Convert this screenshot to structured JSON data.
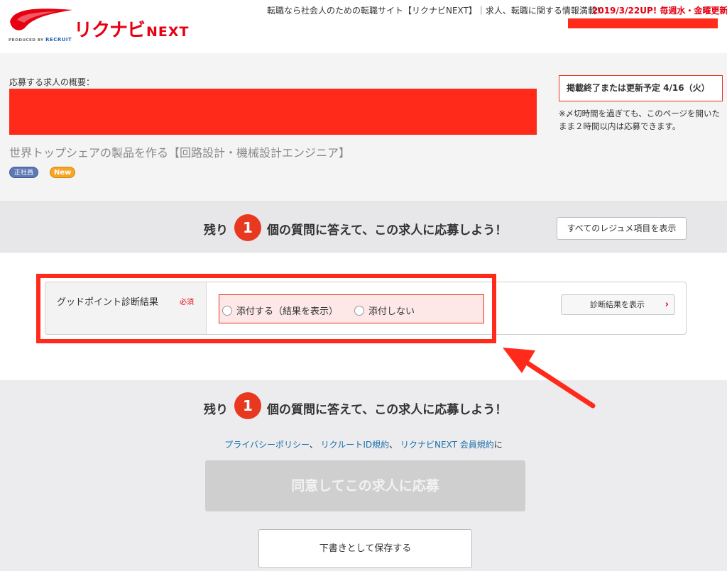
{
  "header": {
    "logo": {
      "main_text": "リクナビ",
      "next_text": "NEXT",
      "produced_by": "PRODUCED BY",
      "recruit": "RECRUIT"
    },
    "tagline": "転職なら社会人のための転職サイト【リクナビNEXT】｜求人、転職に関する情報満載！",
    "update": "2019/3/22UP! 毎週水・金曜更新"
  },
  "overview": {
    "label": "応募する求人の概要：",
    "job_title": "世界トップシェアの製品を作る【回路設計・機械設計エンジニア】",
    "badges": {
      "seisha": "正社員",
      "new": "New"
    },
    "deadline": "掲載終了または更新予定 4/16（火）",
    "deadline_note": "※〆切時間を過ぎても、このページを開いたまま２時間以内は応募できます。"
  },
  "question_band": {
    "prefix": "残り",
    "count": "1",
    "suffix": "個の質問に答えて、この求人に応募しよう！",
    "show_all_button": "すべてのレジュメ項目を表示"
  },
  "form": {
    "label": "グッドポイント診断結果",
    "required": "必須",
    "options": [
      "添付する（結果を表示）",
      "添付しない"
    ],
    "diag_button": "診断結果を表示"
  },
  "bottom": {
    "prefix": "残り",
    "count": "1",
    "suffix": "個の質問に答えて、この求人に応募しよう！",
    "policy_links": [
      "プライバシーポリシー",
      "リクルートID規約",
      "リクナビNEXT 会員規約"
    ],
    "policy_sep": "、",
    "policy_tail": "に",
    "apply_button": "同意してこの求人に応募",
    "save_button": "下書きとして保存する"
  },
  "colors": {
    "accent": "#e60012",
    "redaction": "#ff2a1a",
    "link": "#1a6fa8"
  }
}
